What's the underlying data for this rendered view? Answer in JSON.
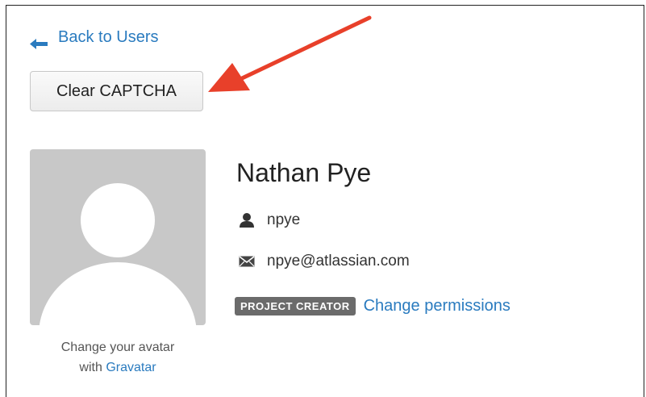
{
  "nav": {
    "back_label": "Back to Users"
  },
  "actions": {
    "clear_captcha_label": "Clear CAPTCHA"
  },
  "avatar": {
    "caption_line1": "Change your avatar",
    "caption_prefix": "with ",
    "caption_link": "Gravatar"
  },
  "user": {
    "full_name": "Nathan Pye",
    "username": "npye",
    "email": "npye@atlassian.com",
    "role_badge": "PROJECT CREATOR",
    "change_permissions_label": "Change permissions"
  },
  "icons": {
    "back": "back-arrow-icon",
    "user": "person-icon",
    "email": "envelope-icon",
    "annotation": "red-arrow-annotation"
  },
  "colors": {
    "link": "#2a7bbf",
    "badge_bg": "#6b6b6b",
    "avatar_bg": "#c8c8c8",
    "annotation_arrow": "#e8402a"
  }
}
